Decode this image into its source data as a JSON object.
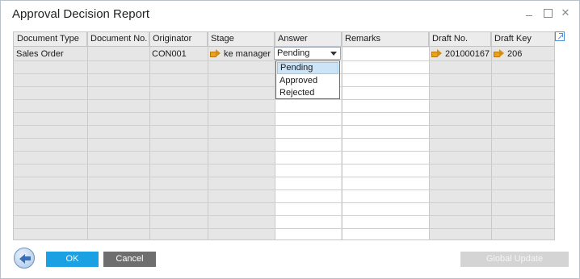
{
  "window": {
    "title": "Approval Decision Report"
  },
  "grid": {
    "columns": [
      "Document Type",
      "Document No.",
      "Originator",
      "Stage",
      "Answer",
      "Remarks",
      "Draft No.",
      "Draft Key"
    ],
    "row": {
      "document_type": "Sales Order",
      "document_no": "",
      "originator": "CON001",
      "stage": "ke manager",
      "answer": "Pending",
      "remarks": "",
      "draft_no": "201000167",
      "draft_key": "206"
    }
  },
  "answer_dropdown": {
    "options": [
      "Pending",
      "Approved",
      "Rejected"
    ],
    "highlighted": "Pending"
  },
  "buttons": {
    "ok": "OK",
    "cancel": "Cancel",
    "global_update": "Global Update"
  },
  "colors": {
    "ok_button": "#1aa0e3",
    "cancel_button": "#6e6e6e",
    "disabled_button": "#d4d4d4",
    "link_arrow": "#e9a11e"
  }
}
